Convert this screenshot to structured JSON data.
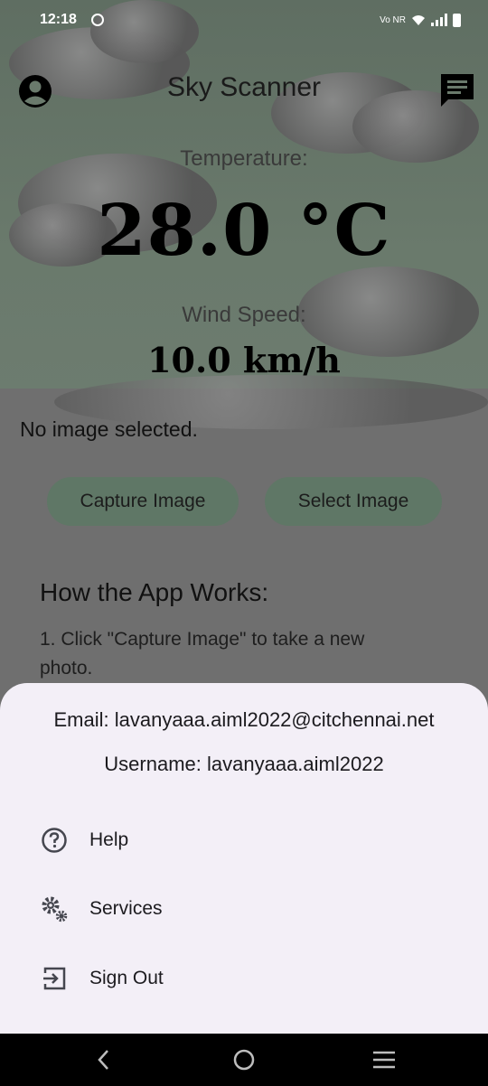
{
  "status_bar": {
    "time": "12:18",
    "network_label": "Vo NR"
  },
  "app_bar": {
    "title": "Sky Scanner",
    "profile_icon": "account-circle-icon",
    "chat_icon": "chat-icon"
  },
  "weather": {
    "temperature_label": "Temperature:",
    "temperature_value": "28.0 °C",
    "wind_label": "Wind Speed:",
    "wind_value": "10.0 km/h"
  },
  "image_status": "No image selected.",
  "buttons": {
    "capture": "Capture Image",
    "select": "Select Image"
  },
  "how_it_works": {
    "title": "How the App Works:",
    "steps": [
      "1. Click \"Capture Image\" to take a new photo."
    ]
  },
  "sheet": {
    "email": "Email: lavanyaaa.aiml2022@citchennai.net",
    "username": "Username: lavanyaaa.aiml2022",
    "items": [
      {
        "label": "Help",
        "icon": "help-circle-icon"
      },
      {
        "label": "Services",
        "icon": "gears-icon"
      },
      {
        "label": "Sign Out",
        "icon": "sign-out-icon"
      }
    ]
  },
  "nav": {
    "back": "back-icon",
    "home": "home-icon",
    "recents": "recents-icon"
  },
  "colors": {
    "sheet_bg": "#f3eff7",
    "button_bg": "#5f7766",
    "scrim": "#6f6f6f"
  }
}
